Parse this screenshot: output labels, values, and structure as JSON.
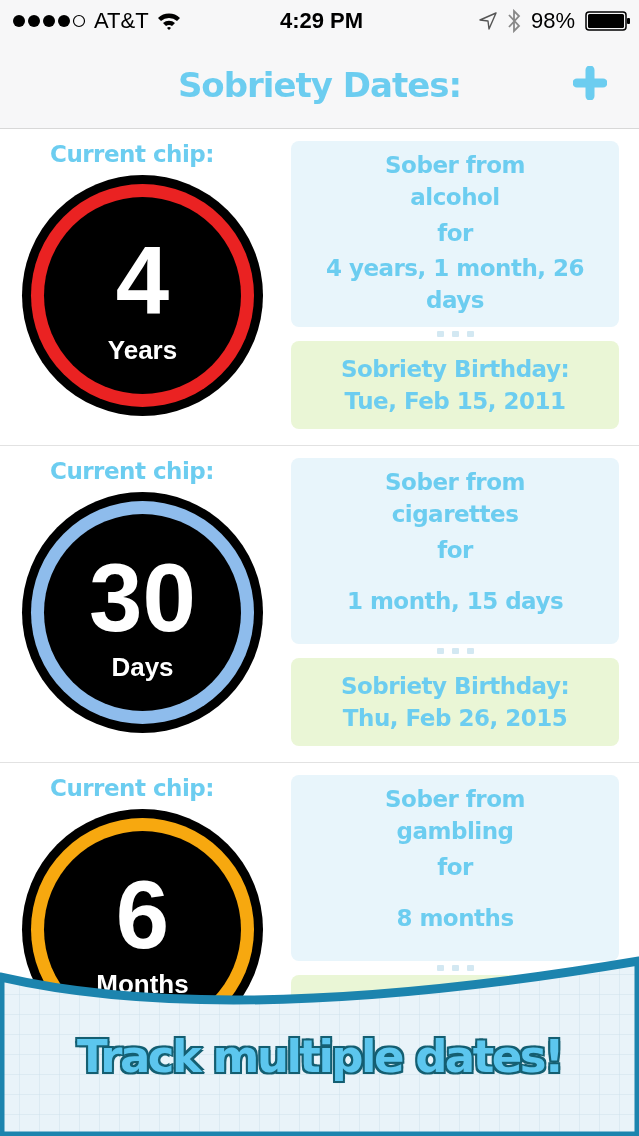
{
  "status_bar": {
    "carrier": "AT&T",
    "time": "4:29 PM",
    "battery": "98%"
  },
  "header": {
    "title": "Sobriety Dates:"
  },
  "dates": [
    {
      "chip_label": "Current chip:",
      "chip_number": "4",
      "chip_unit": "Years",
      "color": "#ea2222",
      "sober_from": "Sober from",
      "substance": "alcohol",
      "for": "for",
      "duration": "4 years, 1 month, 26 days",
      "birthday_label": "Sobriety Birthday:",
      "birthday": "Tue, Feb 15, 2011"
    },
    {
      "chip_label": "Current chip:",
      "chip_number": "30",
      "chip_unit": "Days",
      "color": "#8ebcec",
      "sober_from": "Sober from",
      "substance": "cigarettes",
      "for": "for",
      "duration": "1 month, 15 days",
      "birthday_label": "Sobriety Birthday:",
      "birthday": "Thu, Feb 26, 2015"
    },
    {
      "chip_label": "Current chip:",
      "chip_number": "6",
      "chip_unit": "Months",
      "color": "#f7a80f",
      "sober_from": "Sober from",
      "substance": "gambling",
      "for": "for",
      "duration": "8 months"
    }
  ],
  "banner": {
    "text": "Track multiple dates!"
  }
}
